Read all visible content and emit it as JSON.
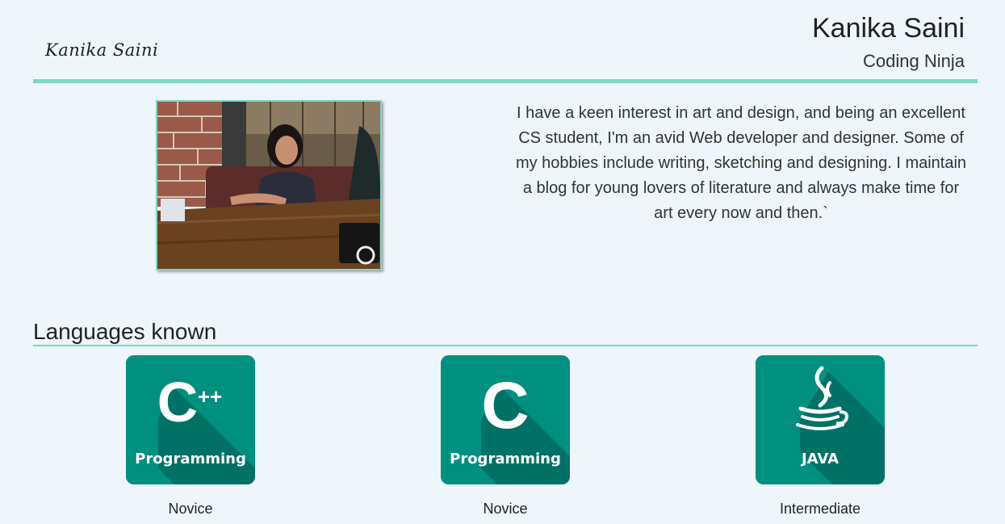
{
  "header": {
    "logo_text": "Kanika Saini",
    "name": "Kanika Saini",
    "tagline": "Coding Ninja"
  },
  "about": {
    "photo_alt": "Profile photo",
    "bio": "I have a keen interest in art and design, and being an excellent CS student, I'm an avid Web developer and designer. Some of my hobbies include writing, sketching and designing. I maintain a blog for young lovers of literature and always make time for art every now and then.`"
  },
  "languages": {
    "title": "Languages known",
    "items": [
      {
        "icon": "cpp-icon",
        "glyph": "C",
        "superscript": "++",
        "caption": "Programming",
        "level": "Novice"
      },
      {
        "icon": "c-icon",
        "glyph": "C",
        "superscript": "",
        "caption": "Programming",
        "level": "Novice"
      },
      {
        "icon": "java-icon",
        "glyph": "",
        "superscript": "",
        "caption": "JAVA",
        "level": "Intermediate"
      }
    ]
  },
  "colors": {
    "accent": "#7fd6c3",
    "tile": "#00907f",
    "tile_shadow": "#006d60",
    "background": "#eef5fb"
  }
}
